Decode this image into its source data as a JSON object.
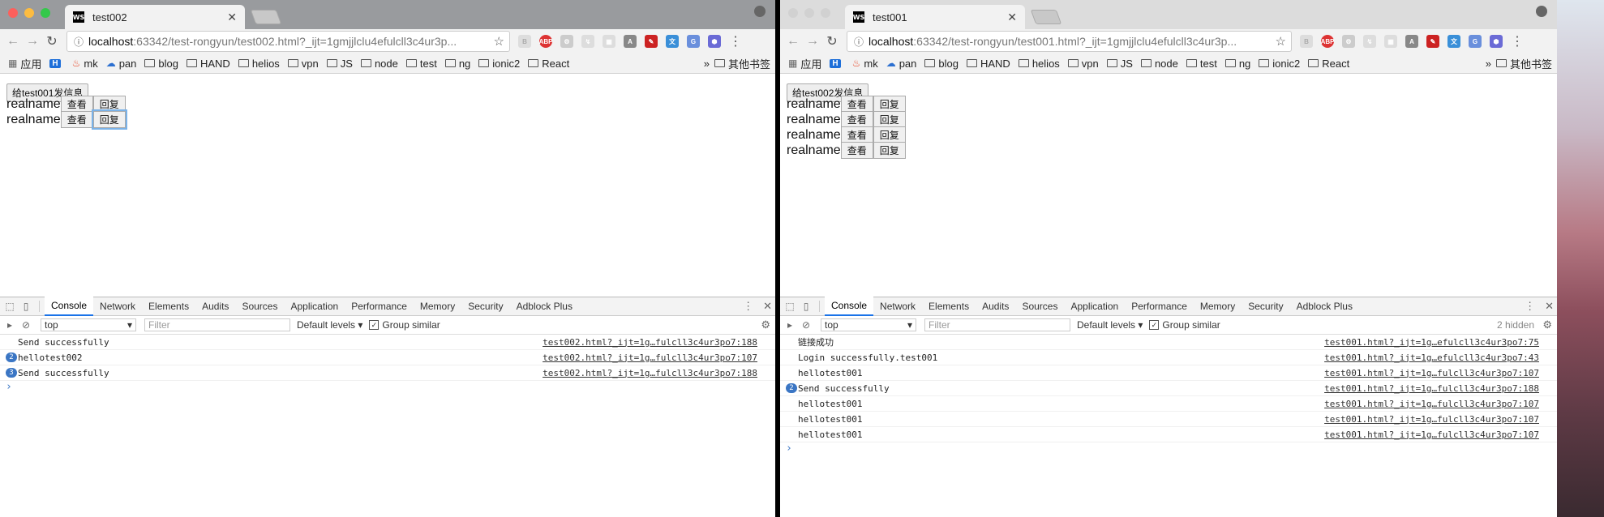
{
  "colors": {
    "close": "#fc605c",
    "minimize": "#fdbc40",
    "maximize": "#34c84a",
    "inactive_light": "#d1d1d1",
    "focus_ring": "#7ab2e8",
    "link_blue": "#3b76c4"
  },
  "windows": [
    {
      "tab_title": "test002",
      "favicon": "WS",
      "url_host": "localhost",
      "url_rest": ":63342/test-rongyun/test002.html?_ijt=1gmjjlclu4efulcll3c4ur3p...",
      "bookmarks": [
        {
          "label": "应用",
          "icon": "apps-icon"
        },
        {
          "label": "",
          "icon": "h-icon"
        },
        {
          "label": "mk",
          "icon": "flame-icon"
        },
        {
          "label": "pan",
          "icon": "cloud-icon"
        },
        {
          "label": "blog",
          "icon": "folder-icon"
        },
        {
          "label": "HAND",
          "icon": "folder-icon"
        },
        {
          "label": "helios",
          "icon": "folder-icon"
        },
        {
          "label": "vpn",
          "icon": "folder-icon"
        },
        {
          "label": "JS",
          "icon": "folder-icon"
        },
        {
          "label": "node",
          "icon": "folder-icon"
        },
        {
          "label": "test",
          "icon": "folder-icon"
        },
        {
          "label": "ng",
          "icon": "folder-icon"
        },
        {
          "label": "ionic2",
          "icon": "folder-icon"
        },
        {
          "label": "React",
          "icon": "folder-icon"
        }
      ],
      "bookmarks_more": "»",
      "other_bookmarks": "其他书签",
      "send_button": "给test001发信息",
      "rows": [
        {
          "label": "realname",
          "view": "查看",
          "reply": "回复"
        },
        {
          "label": "realname",
          "view": "查看",
          "reply": "回复"
        }
      ],
      "devtools": {
        "tabs": [
          "Console",
          "Network",
          "Elements",
          "Audits",
          "Sources",
          "Application",
          "Performance",
          "Memory",
          "Security",
          "Adblock Plus"
        ],
        "context": "top",
        "filter_placeholder": "Filter",
        "levels": "Default levels",
        "group_similar": "Group similar",
        "hidden_count": "",
        "logs": [
          {
            "count": "",
            "message": "Send successfully",
            "source": "test002.html?_ijt=1g…fulcll3c4ur3po7:188"
          },
          {
            "count": "2",
            "message": "hellotest002",
            "source": "test002.html?_ijt=1g…fulcll3c4ur3po7:107"
          },
          {
            "count": "3",
            "message": "Send successfully",
            "source": "test002.html?_ijt=1g…fulcll3c4ur3po7:188"
          }
        ],
        "prompt": "›"
      }
    },
    {
      "tab_title": "test001",
      "favicon": "WS",
      "url_host": "localhost",
      "url_rest": ":63342/test-rongyun/test001.html?_ijt=1gmjjlclu4efulcll3c4ur3p...",
      "bookmarks": [
        {
          "label": "应用",
          "icon": "apps-icon"
        },
        {
          "label": "",
          "icon": "h-icon"
        },
        {
          "label": "mk",
          "icon": "flame-icon"
        },
        {
          "label": "pan",
          "icon": "cloud-icon"
        },
        {
          "label": "blog",
          "icon": "folder-icon"
        },
        {
          "label": "HAND",
          "icon": "folder-icon"
        },
        {
          "label": "helios",
          "icon": "folder-icon"
        },
        {
          "label": "vpn",
          "icon": "folder-icon"
        },
        {
          "label": "JS",
          "icon": "folder-icon"
        },
        {
          "label": "node",
          "icon": "folder-icon"
        },
        {
          "label": "test",
          "icon": "folder-icon"
        },
        {
          "label": "ng",
          "icon": "folder-icon"
        },
        {
          "label": "ionic2",
          "icon": "folder-icon"
        },
        {
          "label": "React",
          "icon": "folder-icon"
        }
      ],
      "bookmarks_more": "»",
      "other_bookmarks": "其他书签",
      "send_button": "给test002发信息",
      "rows": [
        {
          "label": "realname",
          "view": "查看",
          "reply": "回复"
        },
        {
          "label": "realname",
          "view": "查看",
          "reply": "回复"
        },
        {
          "label": "realname",
          "view": "查看",
          "reply": "回复"
        },
        {
          "label": "realname",
          "view": "查看",
          "reply": "回复"
        }
      ],
      "devtools": {
        "tabs": [
          "Console",
          "Network",
          "Elements",
          "Audits",
          "Sources",
          "Application",
          "Performance",
          "Memory",
          "Security",
          "Adblock Plus"
        ],
        "context": "top",
        "filter_placeholder": "Filter",
        "levels": "Default levels",
        "group_similar": "Group similar",
        "hidden_count": "2 hidden",
        "logs": [
          {
            "count": "",
            "message": "链接成功",
            "source": "test001.html?_ijt=1g…efulcll3c4ur3po7:75"
          },
          {
            "count": "",
            "message": "Login successfully.test001",
            "source": "test001.html?_ijt=1g…efulcll3c4ur3po7:43"
          },
          {
            "count": "",
            "message": "hellotest001",
            "source": "test001.html?_ijt=1g…fulcll3c4ur3po7:107"
          },
          {
            "count": "2",
            "message": "Send successfully",
            "source": "test001.html?_ijt=1g…fulcll3c4ur3po7:188"
          },
          {
            "count": "",
            "message": "hellotest001",
            "source": "test001.html?_ijt=1g…fulcll3c4ur3po7:107"
          },
          {
            "count": "",
            "message": "hellotest001",
            "source": "test001.html?_ijt=1g…fulcll3c4ur3po7:107"
          },
          {
            "count": "",
            "message": "hellotest001",
            "source": "test001.html?_ijt=1g…fulcll3c4ur3po7:107"
          }
        ],
        "prompt": "›"
      }
    }
  ]
}
